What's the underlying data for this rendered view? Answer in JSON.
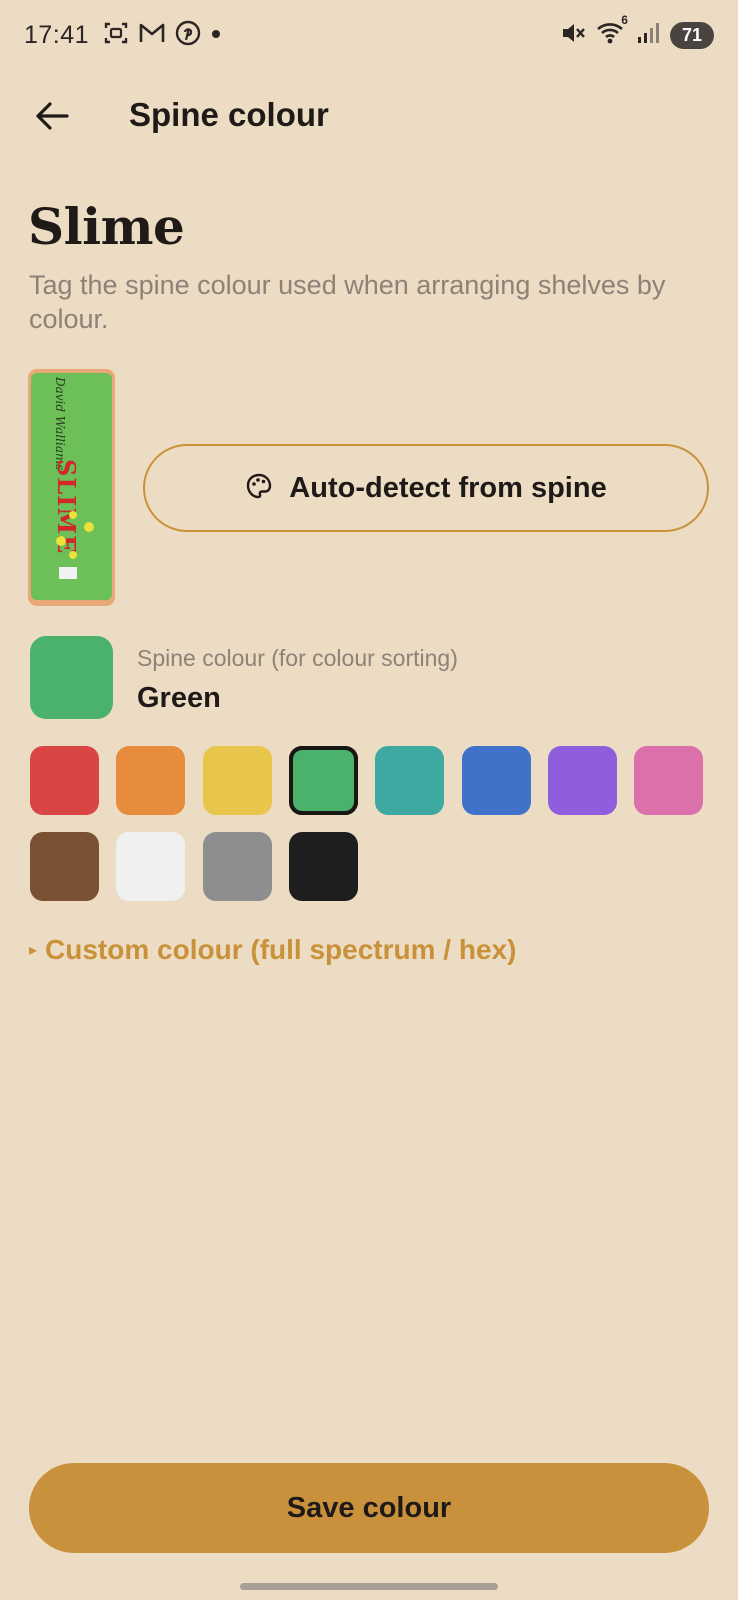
{
  "status_bar": {
    "time": "17:41",
    "left_icons": [
      "screenshot-icon",
      "gmail-icon",
      "pinterest-icon",
      "dot-icon"
    ],
    "right_icons": [
      "mute-icon",
      "wifi-icon",
      "signal-icon"
    ],
    "wifi_badge": "6",
    "battery": "71"
  },
  "app_bar": {
    "back_icon": "arrow-left-icon",
    "title": "Spine colour"
  },
  "book": {
    "title": "Slime",
    "subtitle": "Tag the spine colour used when arranging shelves by colour.",
    "spine_text": "SLIME",
    "spine_author": "David Walliams"
  },
  "detect_button": {
    "icon": "palette-icon",
    "label": "Auto-detect from spine"
  },
  "current_colour": {
    "caption": "Spine colour (for colour sorting)",
    "name": "Green",
    "hex": "#4bb26c"
  },
  "palette": [
    {
      "name": "Red",
      "hex": "#d94545",
      "selected": false
    },
    {
      "name": "Orange",
      "hex": "#e68c3c",
      "selected": false
    },
    {
      "name": "Yellow",
      "hex": "#e8c64b",
      "selected": false
    },
    {
      "name": "Green",
      "hex": "#4bb26c",
      "selected": true
    },
    {
      "name": "Teal",
      "hex": "#3da9a1",
      "selected": false
    },
    {
      "name": "Blue",
      "hex": "#3f72c8",
      "selected": false
    },
    {
      "name": "Purple",
      "hex": "#905ddc",
      "selected": false
    },
    {
      "name": "Pink",
      "hex": "#dc70aa",
      "selected": false
    },
    {
      "name": "Brown",
      "hex": "#7a5233",
      "selected": false
    },
    {
      "name": "White",
      "hex": "#f0f0f0",
      "selected": false
    },
    {
      "name": "Grey",
      "hex": "#8e8e8e",
      "selected": false
    },
    {
      "name": "Black",
      "hex": "#1e1e1e",
      "selected": false
    }
  ],
  "custom_colour": {
    "marker": "▸",
    "label": "Custom colour (full spectrum / hex)"
  },
  "save_button": {
    "label": "Save colour"
  },
  "colors": {
    "background": "#ecdcc3",
    "accent": "#c9913b",
    "muted_text": "#8e8278"
  }
}
